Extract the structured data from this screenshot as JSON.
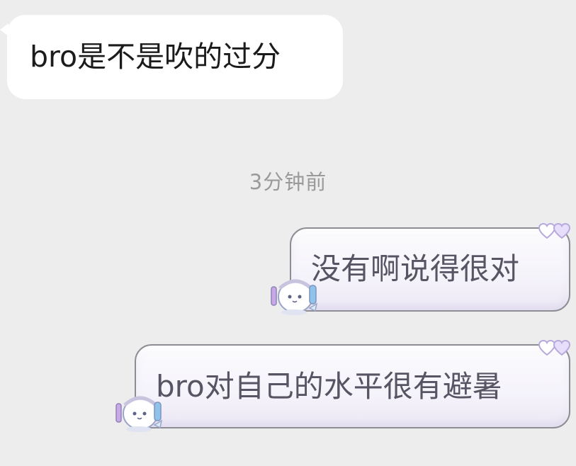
{
  "messages": [
    {
      "sender": "other",
      "text": "bro是不是吹的过分"
    },
    {
      "type": "time_divider",
      "text": "3分钟前"
    },
    {
      "sender": "me",
      "text": "没有啊说得很对"
    },
    {
      "sender": "me",
      "text": "bro对自己的水平很有避暑"
    }
  ],
  "decorations": {
    "bubble_corner_icon": "hearts-icon",
    "bubble_mascot_icon": "mascot-sticker-icon",
    "colors": {
      "background": "#ededed",
      "incoming_bubble": "#ffffff",
      "outgoing_bubble_border": "#8d8d94",
      "outgoing_text": "#575564",
      "timestamp_text": "#9a9a9a"
    }
  }
}
